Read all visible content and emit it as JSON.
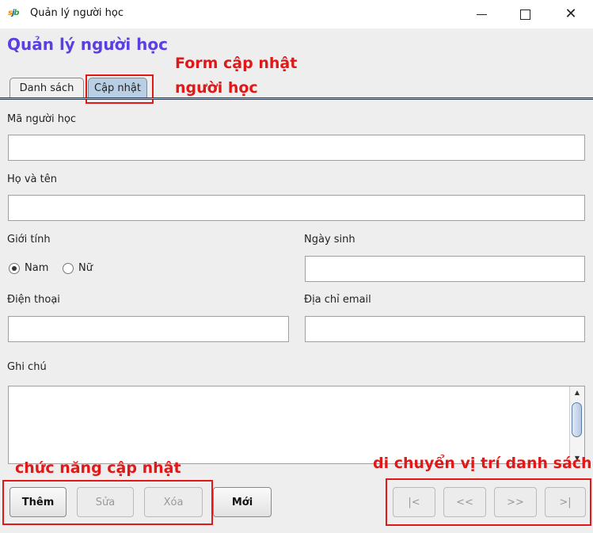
{
  "window": {
    "logo_parts": [
      "s",
      "j",
      "b"
    ],
    "title": "Quản lý người học",
    "controls": {
      "minimize": "",
      "maximize": "",
      "close": "✕"
    }
  },
  "page": {
    "title": "Quản lý người học"
  },
  "tabs": [
    {
      "label": "Danh sách",
      "active": false
    },
    {
      "label": "Cập nhật",
      "active": true
    }
  ],
  "annotations": {
    "form_line1": "Form cập nhật",
    "form_line2": "người học",
    "functions": "chức năng cập nhật",
    "navigation": "di chuyển vị trí danh sách",
    "color": "#e01818"
  },
  "form": {
    "student_id": {
      "label": "Mã người học",
      "value": "",
      "placeholder": ""
    },
    "full_name": {
      "label": "Họ và tên",
      "value": "",
      "placeholder": ""
    },
    "gender": {
      "label": "Giới tính",
      "options": [
        "Nam",
        "Nữ"
      ],
      "selected": "Nam"
    },
    "birth_date": {
      "label": "Ngày sinh",
      "value": ""
    },
    "phone": {
      "label": "Điện thoại",
      "value": ""
    },
    "email": {
      "label": "Địa chỉ email",
      "value": ""
    },
    "notes": {
      "label": "Ghi chú",
      "value": ""
    }
  },
  "actions": {
    "add": "Thêm",
    "edit": "Sửa",
    "delete": "Xóa",
    "new": "Mới"
  },
  "navigation": {
    "first": "|<",
    "prev": "<<",
    "next": ">>",
    "last": ">|"
  },
  "colors": {
    "title": "#5b3fe0",
    "active_tab": "#b8cfe5",
    "highlight": "#e01818"
  }
}
